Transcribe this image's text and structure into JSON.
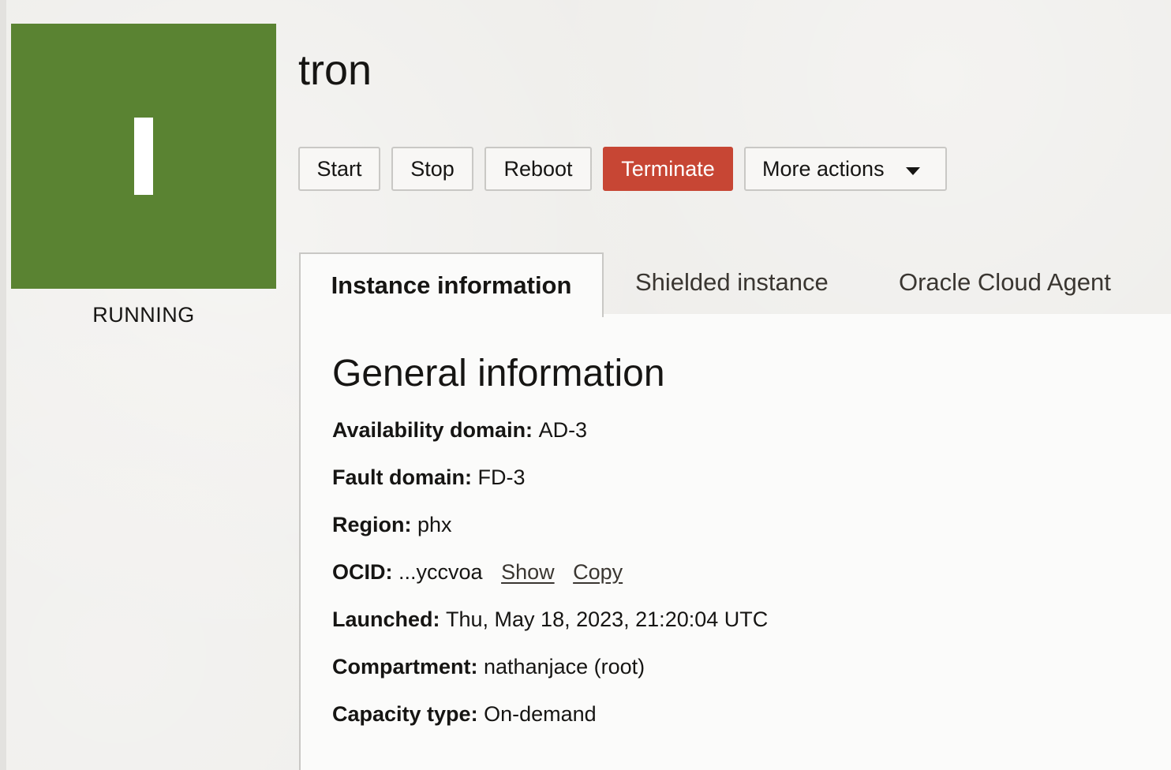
{
  "status": {
    "letter": "I",
    "text": "RUNNING",
    "color": "#5a8332"
  },
  "title": "tron",
  "actions": {
    "start": "Start",
    "stop": "Stop",
    "reboot": "Reboot",
    "terminate": "Terminate",
    "more": "More actions",
    "terminate_color": "#c74634"
  },
  "tabs": [
    {
      "label": "Instance information",
      "active": true
    },
    {
      "label": "Shielded instance",
      "active": false
    },
    {
      "label": "Oracle Cloud Agent",
      "active": false
    }
  ],
  "general": {
    "heading": "General information",
    "rows": [
      {
        "label": "Availability domain:",
        "value": "AD-3"
      },
      {
        "label": "Fault domain:",
        "value": "FD-3"
      },
      {
        "label": "Region:",
        "value": "phx"
      },
      {
        "label": "OCID:",
        "value": "...yccvoa"
      },
      {
        "label": "Launched:",
        "value": "Thu, May 18, 2023, 21:20:04 UTC"
      },
      {
        "label": "Compartment:",
        "value": "nathanjace (root)"
      },
      {
        "label": "Capacity type:",
        "value": "On-demand"
      }
    ],
    "ocid_show": "Show",
    "ocid_copy": "Copy"
  }
}
